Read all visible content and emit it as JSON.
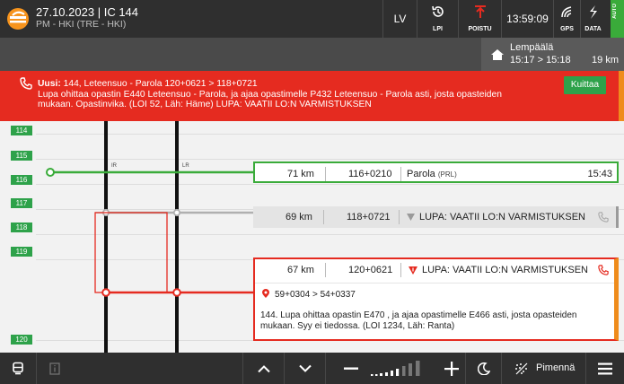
{
  "header": {
    "date": "27.10.2023",
    "train": "IC 144",
    "route": "PM - HKI (TRE - HKI)",
    "language": "LV",
    "lpi_label": "LPI",
    "exit_label": "POISTU",
    "clock": "13:59:09",
    "gps_label": "GPS",
    "data_label": "DATA",
    "auto_label": "AUTO"
  },
  "next_station": {
    "name": "Lempäälä",
    "times": "15:17 > 15:18",
    "distance": "19 km"
  },
  "alert": {
    "prefix": "Uusi:",
    "line1": " 144, Leteensuo - Parola 120+0621 > 118+0721",
    "line2": "Lupa ohittaa opastin E440 Leteensuo - Parola, ja ajaa opastimelle P432 Leteensuo - Parola asti, josta opasteiden",
    "line3": "mukaan. Opastinvika. (LOI 52, Läh: Häme) LUPA: VAATII LO:N VARMISTUKSEN",
    "ack_label": "Kuittaa"
  },
  "km_markers": [
    "114",
    "115",
    "116",
    "117",
    "118",
    "119",
    "120"
  ],
  "track_labels": [
    "IR",
    "LR"
  ],
  "rows": {
    "station": {
      "km": "71 km",
      "position": "116+0210",
      "name": "Parola",
      "code": "(PRL)",
      "time": "15:43"
    },
    "permit_old": {
      "km": "69 km",
      "position": "118+0721",
      "text": "LUPA: VAATII LO:N VARMISTUKSEN"
    },
    "permit_new": {
      "km": "67 km",
      "position": "120+0621",
      "text": "LUPA: VAATII LO:N VARMISTUKSEN",
      "location": "59+0304 > 54+0337",
      "details": "144. Lupa ohittaa opastin E470 , ja ajaa opastimelle  E466  asti, josta opasteiden mukaan. Syy ei tiedossa. (LOI 1234, Läh: Ranta)"
    }
  },
  "bottom": {
    "dim_label": "Pimennä"
  },
  "colors": {
    "green": "#3aab3a",
    "red": "#e52b20",
    "orange": "#ef8c1c",
    "dark": "#2f2f2f"
  }
}
